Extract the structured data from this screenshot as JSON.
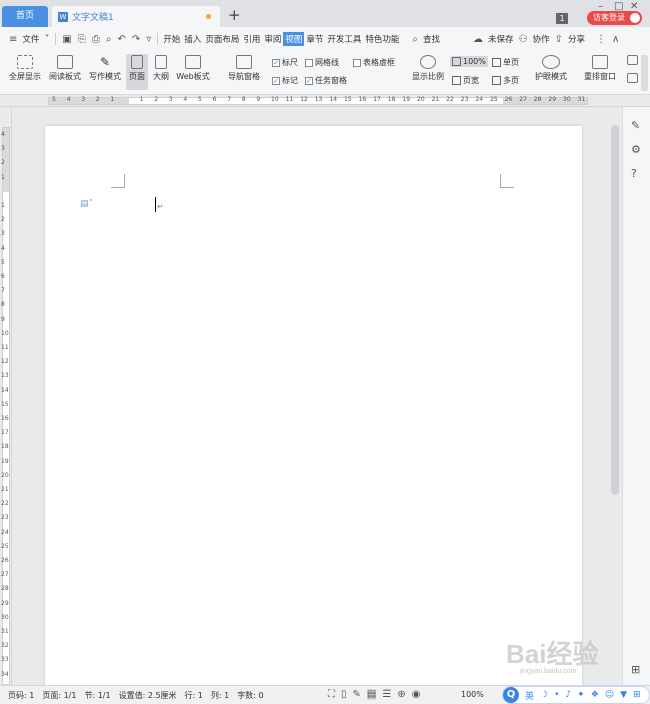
{
  "titlebar": {
    "home_tab": "首页",
    "doc_tab": "文字文稿1",
    "add_tab": "+",
    "badge": "1",
    "login": "访客登录"
  },
  "menubar": {
    "file": "文件",
    "menus": [
      "开始",
      "插入",
      "页面布局",
      "引用",
      "审阅",
      "视图",
      "章节",
      "开发工具",
      "特色功能"
    ],
    "active_menu": "视图",
    "search": "查找",
    "unsaved": "未保存",
    "collab": "协作",
    "share": "分享"
  },
  "ribbon": {
    "fullscreen": "全屏显示",
    "reading": "阅读板式",
    "writing": "写作模式",
    "page": "页面",
    "outline": "大纲",
    "web": "Web板式",
    "nav_pane": "导航窗格",
    "ruler": "标尺",
    "gridlines": "网格线",
    "table_border": "表格虚框",
    "marks": "标记",
    "task_pane": "任务窗格",
    "zoom": "显示比例",
    "zoom_100": "100%",
    "page_width": "页宽",
    "single_page": "单页",
    "multi_page": "多页",
    "eye_protect": "护眼模式",
    "rearrange": "重排窗口"
  },
  "ruler": {
    "h_labels": [
      "5",
      "4",
      "3",
      "2",
      "1",
      "",
      "1",
      "2",
      "3",
      "4",
      "5",
      "6",
      "7",
      "8",
      "9",
      "10",
      "11",
      "12",
      "13",
      "14",
      "15",
      "16",
      "17",
      "18",
      "19",
      "20",
      "21",
      "22",
      "23",
      "24",
      "25",
      "26",
      "27",
      "28",
      "29",
      "30",
      "31"
    ],
    "v_labels": [
      "4",
      "3",
      "2",
      "1",
      "",
      "1",
      "2",
      "3",
      "4",
      "5",
      "6",
      "7",
      "8",
      "9",
      "10",
      "11",
      "12",
      "13",
      "14",
      "15",
      "16",
      "17",
      "18",
      "19",
      "20",
      "21",
      "22",
      "23",
      "24",
      "25",
      "26",
      "27",
      "28",
      "29",
      "30",
      "31",
      "32",
      "33",
      "34",
      "35"
    ]
  },
  "statusbar": {
    "page_no": "页码: 1",
    "pages": "页面: 1/1",
    "section": "节: 1/1",
    "setting": "设置值: 2.5厘米",
    "row": "行: 1",
    "col": "列: 1",
    "chars": "字数: 0",
    "zoom": "100%",
    "ime_lang": "英"
  },
  "watermark": {
    "text": "Bai经验",
    "sub": "jingyan.baidu.com"
  }
}
